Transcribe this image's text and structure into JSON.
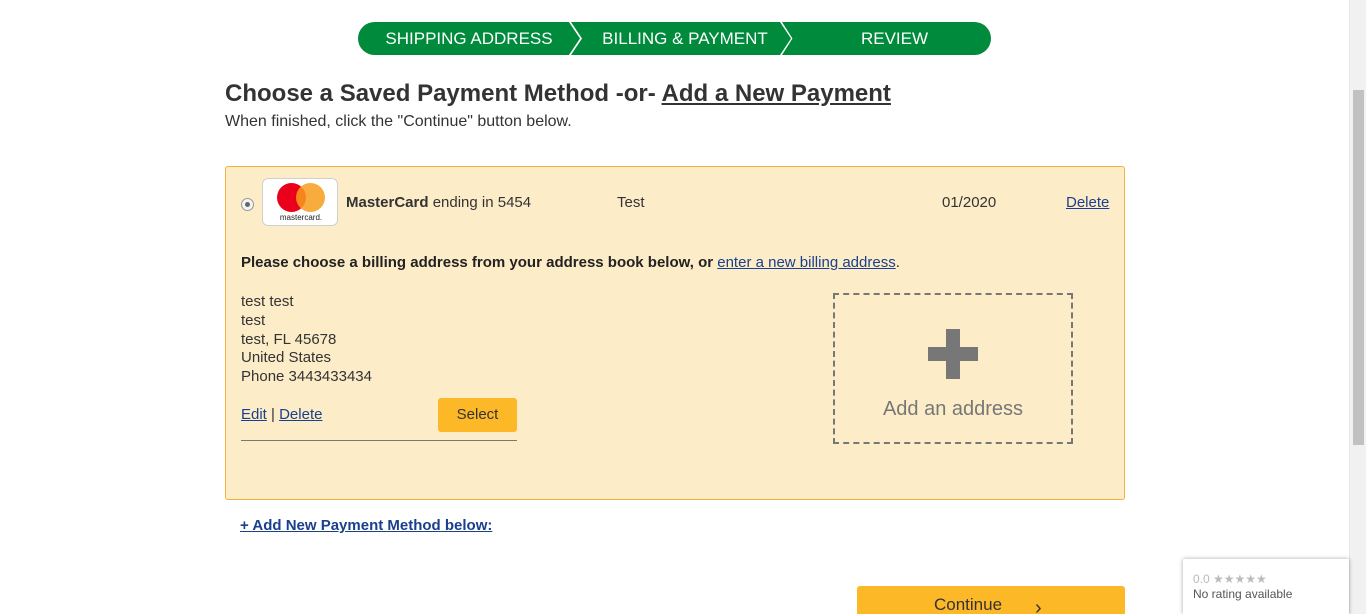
{
  "steps": [
    {
      "label": "SHIPPING ADDRESS"
    },
    {
      "label": "BILLING & PAYMENT"
    },
    {
      "label": "REVIEW"
    }
  ],
  "heading": {
    "prefix": "Choose a Saved Payment Method -or- ",
    "link": "Add a New Payment",
    "subtitle": "When finished, click the \"Continue\" button below."
  },
  "card": {
    "brand": "MasterCard",
    "ending_text": " ending in 5454",
    "logo_text": "mastercard.",
    "holder": "Test",
    "expiry": "01/2020",
    "delete_label": "Delete",
    "selected": true
  },
  "billing": {
    "prompt": "Please choose a billing address from your address book below, or ",
    "new_link": "enter a new billing address",
    "period": ".",
    "address": {
      "line1": "test test",
      "line2": "test",
      "line3": "test, FL 45678",
      "line4": "United States",
      "line5": "Phone 3443433434"
    },
    "edit_label": "Edit",
    "separator": " | ",
    "delete_label": "Delete",
    "select_label": "Select",
    "add_address_label": "Add an address"
  },
  "add_payment_link": "+ Add New Payment Method below:",
  "continue_label": "Continue",
  "continue_chevron": "›",
  "rating": {
    "stars": "0.0 ★★★★★",
    "text": "No rating available"
  },
  "colors": {
    "step_green": "#008a3c",
    "panel_bg": "#fdecc8",
    "panel_border": "#f0b43c",
    "button_yellow": "#fdb827",
    "link_blue": "#1a3f8c"
  }
}
